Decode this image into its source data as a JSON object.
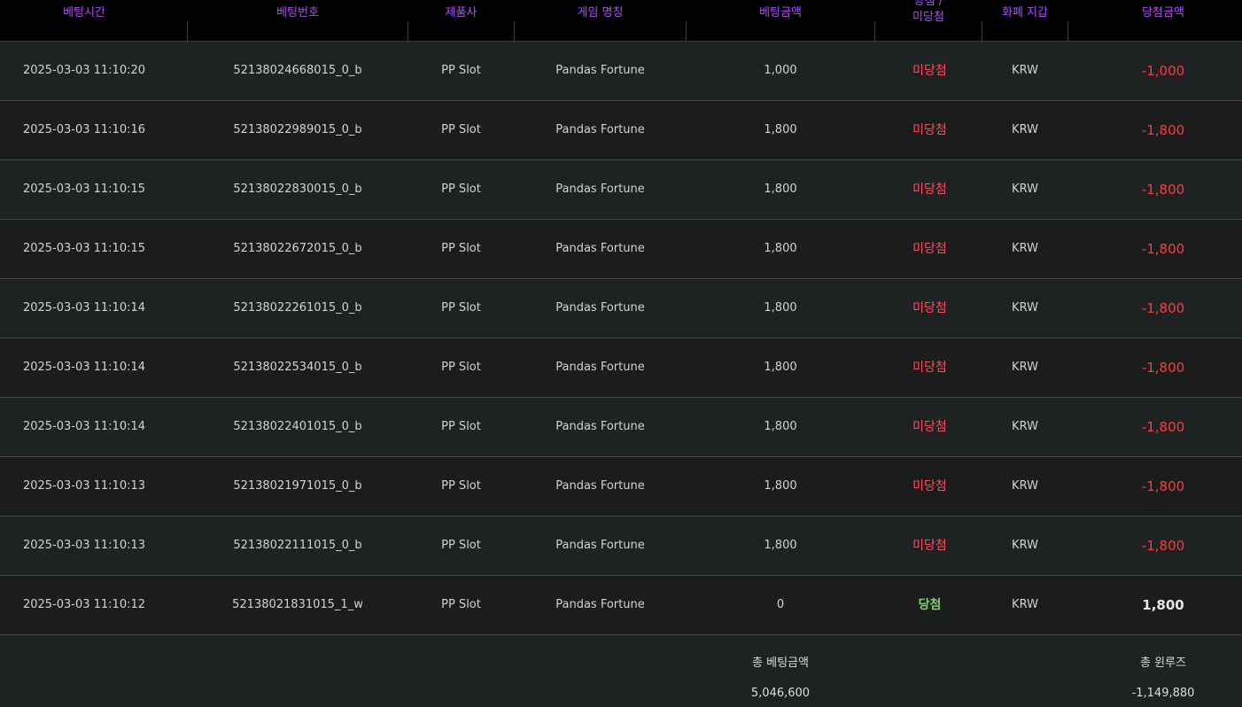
{
  "columns": {
    "bet_time": "베팅시간",
    "bet_number": "베팅번호",
    "provider": "제품사",
    "game_name": "게임 명칭",
    "bet_amount": "베팅금액",
    "result_line1": "당첨 /",
    "result_line2": "미당첨",
    "currency_wallet": "화폐 지갑",
    "win_amount": "당첨금액"
  },
  "rows": [
    {
      "time": "2025-03-03 11:10:20",
      "bet_id": "52138024668015_0_b",
      "provider": "PP Slot",
      "game": "Pandas Fortune",
      "bet": "1,000",
      "result": "미당첨",
      "currency": "KRW",
      "win": "-1,000"
    },
    {
      "time": "2025-03-03 11:10:16",
      "bet_id": "52138022989015_0_b",
      "provider": "PP Slot",
      "game": "Pandas Fortune",
      "bet": "1,800",
      "result": "미당첨",
      "currency": "KRW",
      "win": "-1,800"
    },
    {
      "time": "2025-03-03 11:10:15",
      "bet_id": "52138022830015_0_b",
      "provider": "PP Slot",
      "game": "Pandas Fortune",
      "bet": "1,800",
      "result": "미당첨",
      "currency": "KRW",
      "win": "-1,800"
    },
    {
      "time": "2025-03-03 11:10:15",
      "bet_id": "52138022672015_0_b",
      "provider": "PP Slot",
      "game": "Pandas Fortune",
      "bet": "1,800",
      "result": "미당첨",
      "currency": "KRW",
      "win": "-1,800"
    },
    {
      "time": "2025-03-03 11:10:14",
      "bet_id": "52138022261015_0_b",
      "provider": "PP Slot",
      "game": "Pandas Fortune",
      "bet": "1,800",
      "result": "미당첨",
      "currency": "KRW",
      "win": "-1,800"
    },
    {
      "time": "2025-03-03 11:10:14",
      "bet_id": "52138022534015_0_b",
      "provider": "PP Slot",
      "game": "Pandas Fortune",
      "bet": "1,800",
      "result": "미당첨",
      "currency": "KRW",
      "win": "-1,800"
    },
    {
      "time": "2025-03-03 11:10:14",
      "bet_id": "52138022401015_0_b",
      "provider": "PP Slot",
      "game": "Pandas Fortune",
      "bet": "1,800",
      "result": "미당첨",
      "currency": "KRW",
      "win": "-1,800"
    },
    {
      "time": "2025-03-03 11:10:13",
      "bet_id": "52138021971015_0_b",
      "provider": "PP Slot",
      "game": "Pandas Fortune",
      "bet": "1,800",
      "result": "미당첨",
      "currency": "KRW",
      "win": "-1,800"
    },
    {
      "time": "2025-03-03 11:10:13",
      "bet_id": "52138022111015_0_b",
      "provider": "PP Slot",
      "game": "Pandas Fortune",
      "bet": "1,800",
      "result": "미당첨",
      "currency": "KRW",
      "win": "-1,800"
    },
    {
      "time": "2025-03-03 11:10:12",
      "bet_id": "52138021831015_1_w",
      "provider": "PP Slot",
      "game": "Pandas Fortune",
      "bet": "0",
      "result": "당첨",
      "currency": "KRW",
      "win": "1,800"
    }
  ],
  "summary": {
    "total_bet_label": "총 베팅금액",
    "total_bet_value": "5,046,600",
    "total_winloss_label": "총 윈루즈",
    "total_winloss_value": "-1,149,880"
  },
  "colors": {
    "header_text": "#b04cff",
    "lose_label": "#ff4d5e",
    "win_label": "#7dd36a",
    "negative_amount": "#ff3b3b"
  }
}
